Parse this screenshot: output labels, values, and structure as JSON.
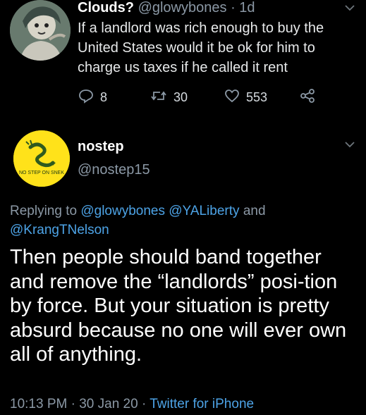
{
  "tweet1": {
    "display_name": "Clouds?",
    "handle": "@glowybones",
    "separator": "·",
    "time": "1d",
    "text": "If a landlord was rich enough to buy the United States would it be ok for him to charge us taxes if he called it rent",
    "replies": "8",
    "retweets": "30",
    "likes": "553"
  },
  "tweet2": {
    "display_name": "nostep",
    "handle": "@nostep15",
    "avatar_text": "NO STEP ON SNEK",
    "replying_to_label": "Replying to",
    "mentions": [
      "@glowybones",
      "@YALiberty",
      "@KrangTNelson"
    ],
    "and_word": "and",
    "body": "Then people should band together and remove the “landlords” posi-tion by force. But your situation is pretty absurd because no one will ever own all of anything.",
    "time": "10:13 PM",
    "date": "30 Jan 20",
    "sep": "·",
    "source": "Twitter for iPhone"
  },
  "colors": {
    "background": "#000000",
    "muted": "#8b98a5",
    "link": "#4da3e6",
    "avatar2_bg": "#ffe21a"
  },
  "icons": [
    "reply-icon",
    "retweet-icon",
    "like-icon",
    "share-icon",
    "chevron-down-icon"
  ]
}
